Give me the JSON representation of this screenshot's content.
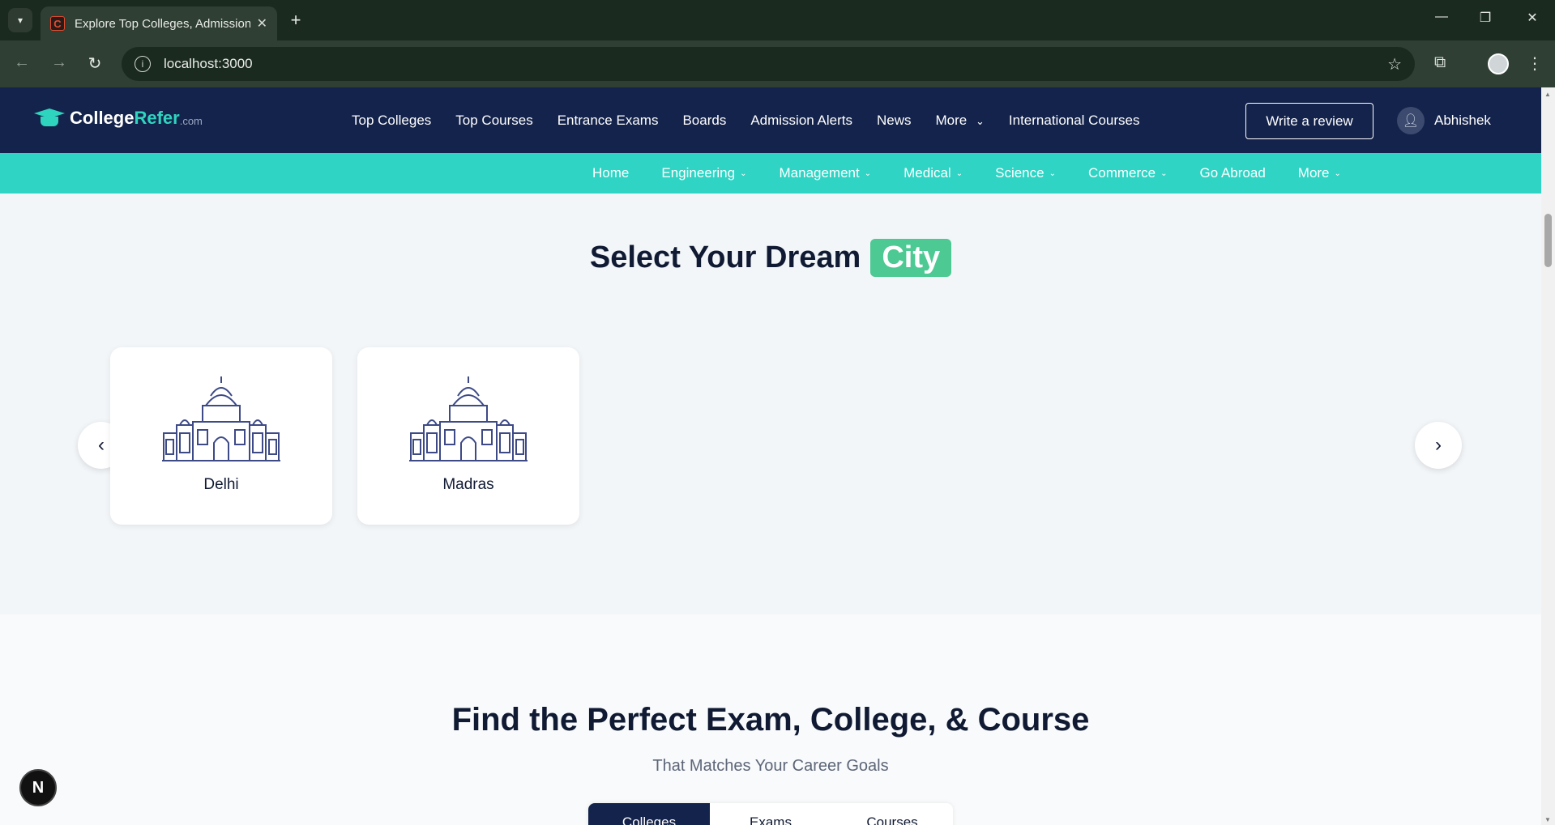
{
  "browser": {
    "tab_title": "Explore Top Colleges, Admissions",
    "tab_favicon": "C",
    "url": "localhost:3000"
  },
  "site": {
    "logo": {
      "name": "CollegeRefer",
      "name_main": "College",
      "name_accent": "Refer",
      "suffix": ".com"
    },
    "main_nav": [
      "Top Colleges",
      "Top Courses",
      "Entrance Exams",
      "Boards",
      "Admission Alerts",
      "News",
      "More",
      "International Courses"
    ],
    "review_button": "Write a review",
    "user_name": "Abhishek",
    "sub_nav": [
      {
        "label": "Home",
        "dropdown": false
      },
      {
        "label": "Engineering",
        "dropdown": true
      },
      {
        "label": "Management",
        "dropdown": true
      },
      {
        "label": "Medical",
        "dropdown": true
      },
      {
        "label": "Science",
        "dropdown": true
      },
      {
        "label": "Commerce",
        "dropdown": true
      },
      {
        "label": "Go Abroad",
        "dropdown": false
      },
      {
        "label": "More",
        "dropdown": true
      }
    ]
  },
  "city_section": {
    "title_prefix": "Select Your Dream",
    "title_highlight": "City",
    "cities": [
      "Delhi",
      "Madras"
    ]
  },
  "find_section": {
    "title": "Find the Perfect Exam, College, & Course",
    "subtitle": "That Matches Your Career Goals",
    "tabs": [
      "Colleges",
      "Exams",
      "Courses"
    ],
    "active_tab": "Colleges"
  },
  "dev_badge": "N",
  "colors": {
    "header_bg": "#14234b",
    "subnav_bg": "#2fd4c4",
    "highlight": "#4dc993"
  }
}
